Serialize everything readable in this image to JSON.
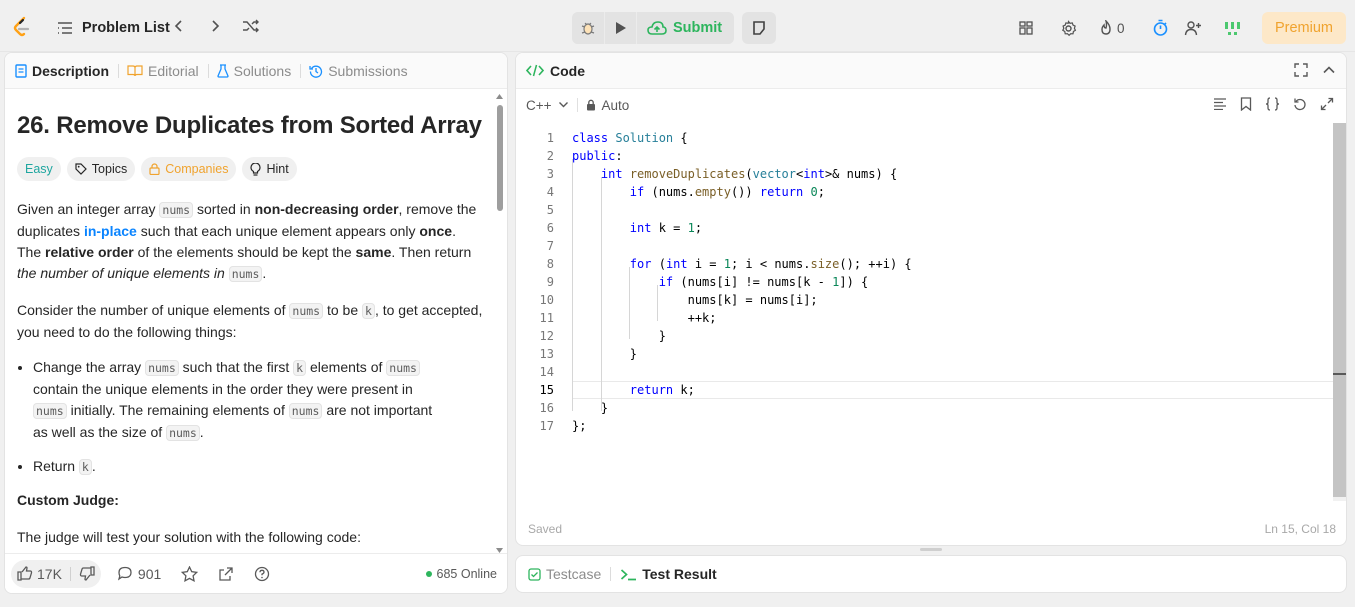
{
  "topbar": {
    "problem_list": "Problem List",
    "submit": "Submit",
    "streak_count": "0",
    "premium": "Premium"
  },
  "left_tabs": [
    "Description",
    "Editorial",
    "Solutions",
    "Submissions"
  ],
  "problem": {
    "title": "26. Remove Duplicates from Sorted Array",
    "tags": [
      "Easy",
      "Topics",
      "Companies",
      "Hint"
    ],
    "p1": {
      "a": "Given an integer array ",
      "code1": "nums",
      "b": " sorted in ",
      "bold1": "non-decreasing order",
      "c": ", remove the duplicates ",
      "link": "in-place",
      "d": " such that each unique element appears only ",
      "bold2": "once",
      "e": ". The ",
      "bold3": "relative order",
      "f": " of the elements should be kept the ",
      "bold4": "same",
      "g": ". Then return ",
      "ital": "the number of unique elements in ",
      "code2": "nums",
      "h": "."
    },
    "p2": {
      "a": "Consider the number of unique elements of ",
      "code1": "nums",
      "b": " to be ",
      "code2": "k",
      "c": ", to get accepted, you need to do the following things:"
    },
    "bullet1": {
      "a": "Change the array ",
      "code1": "nums",
      "b": " such that the first ",
      "code2": "k",
      "c": " elements of ",
      "code3": "nums",
      "d": " contain the unique elements in the order they were present in ",
      "code4": "nums",
      "e": " initially. The remaining elements of ",
      "code5": "nums",
      "f": " are not important as well as the size of ",
      "code6": "nums",
      "g": "."
    },
    "bullet2": {
      "a": "Return ",
      "code1": "k",
      "b": "."
    },
    "custom_judge": "Custom Judge:",
    "p3": "The judge will test your solution with the following code:"
  },
  "footer": {
    "likes": "17K",
    "comments": "901",
    "online": "685 Online"
  },
  "code_panel": {
    "title": "Code",
    "language": "C++",
    "mode": "Auto",
    "saved": "Saved",
    "cursor": "Ln 15, Col 18",
    "line_numbers": [
      "1",
      "2",
      "3",
      "4",
      "5",
      "6",
      "7",
      "8",
      "9",
      "10",
      "11",
      "12",
      "13",
      "14",
      "15",
      "16",
      "17"
    ]
  },
  "bottom_tabs": [
    "Testcase",
    "Test Result"
  ]
}
